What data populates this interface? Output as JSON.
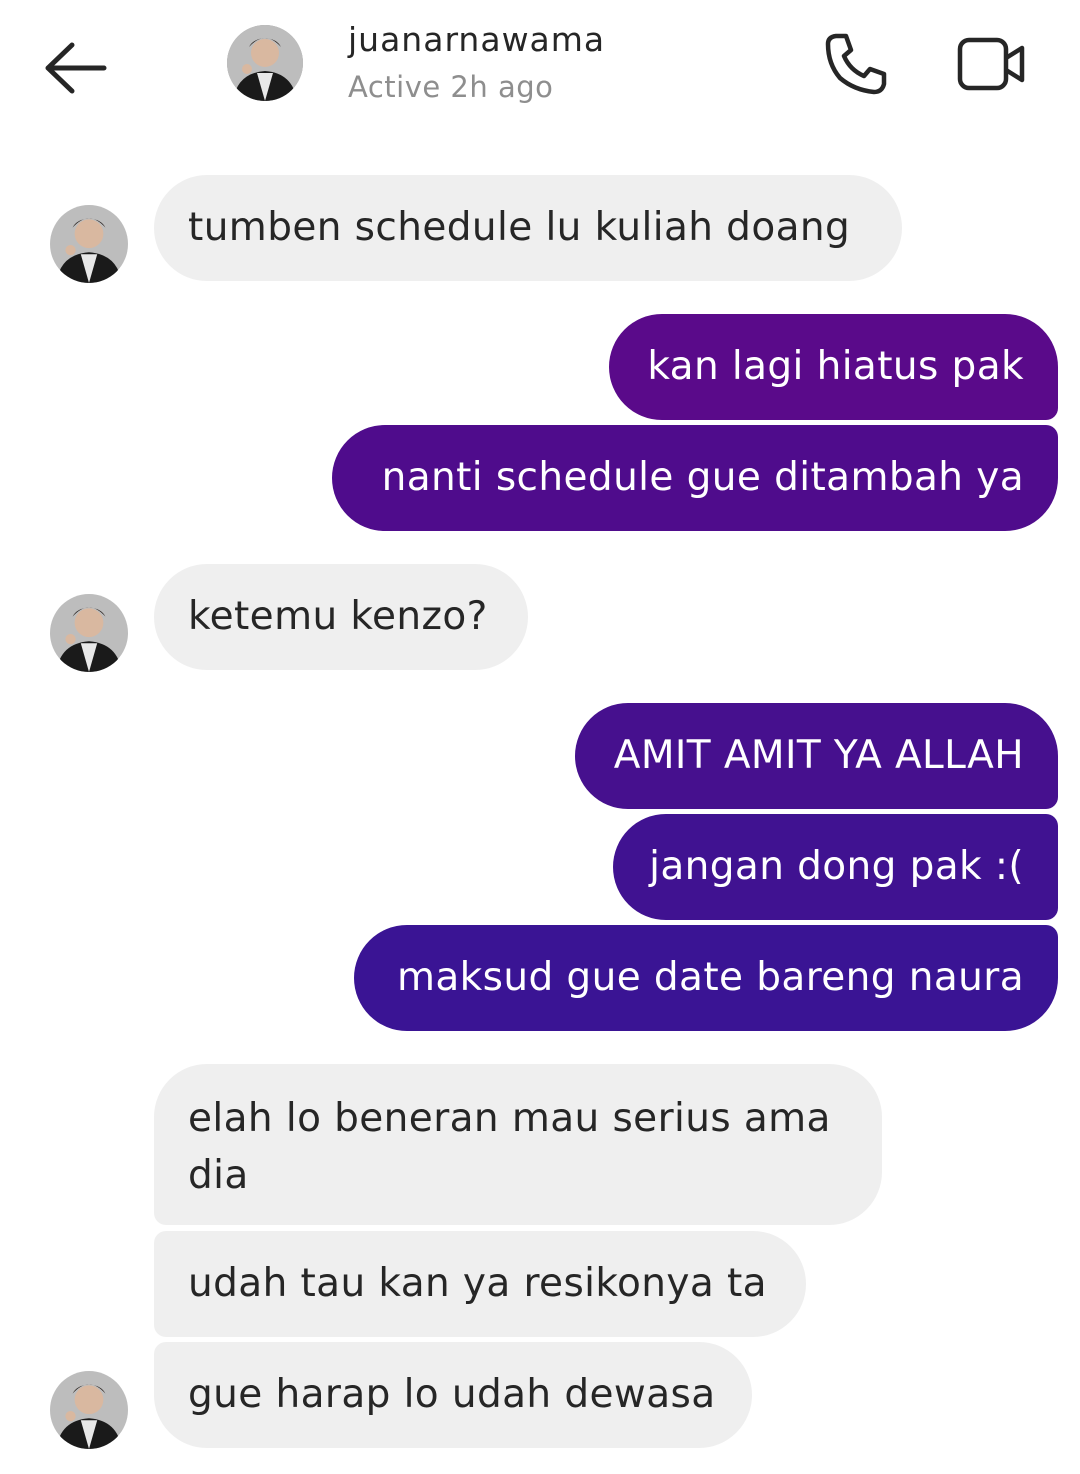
{
  "header": {
    "username": "juanarnawama",
    "status": "Active 2h ago",
    "back_icon": "arrow-left-icon",
    "call_icon": "phone-icon",
    "video_icon": "video-camera-icon"
  },
  "colors": {
    "incoming_bubble": "#efefef",
    "outgoing_gradient_start": "#5a0a9a",
    "outgoing_gradient_end": "#341596",
    "secondary_text": "#8e8e8e"
  },
  "messages": [
    {
      "sender": "them",
      "text": "tumben schedule lu kuliah doang"
    },
    {
      "sender": "me",
      "text": "kan lagi hiatus pak"
    },
    {
      "sender": "me",
      "text": "nanti schedule gue ditambah ya"
    },
    {
      "sender": "them",
      "text": "ketemu kenzo?"
    },
    {
      "sender": "me",
      "text": "AMIT AMIT YA ALLAH"
    },
    {
      "sender": "me",
      "text": "jangan dong pak :("
    },
    {
      "sender": "me",
      "text": "maksud gue date bareng naura"
    },
    {
      "sender": "them",
      "text": "elah lo beneran mau serius ama dia"
    },
    {
      "sender": "them",
      "text": "udah tau kan ya resikonya ta"
    },
    {
      "sender": "them",
      "text": "gue harap lo udah dewasa"
    }
  ]
}
